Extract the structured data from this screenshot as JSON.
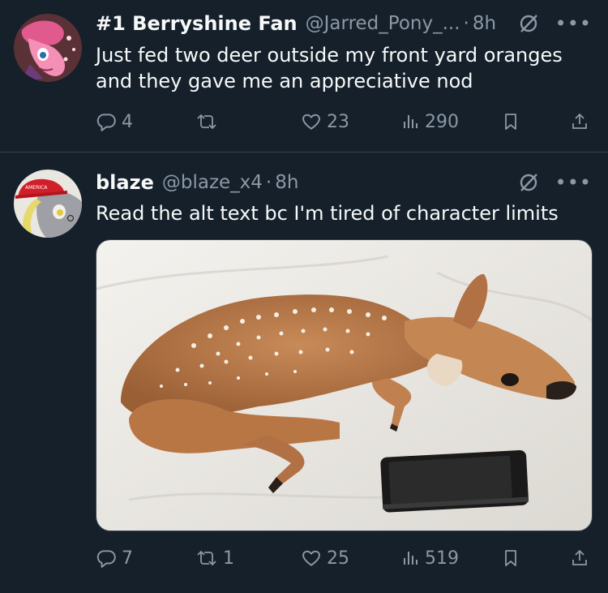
{
  "tweets": [
    {
      "display_name": "#1 Berryshine Fan",
      "handle": "@Jarred_Pony_...",
      "dot": "·",
      "time": "8h",
      "text": "Just fed two deer outside my front yard oranges and they gave me an appreciative nod",
      "avatar": "pink-pony-avatar",
      "replies": "4",
      "retweets": "",
      "likes": "23",
      "views": "290"
    },
    {
      "display_name": "blaze",
      "handle": "@blaze_x4",
      "dot": "·",
      "time": "8h",
      "text": "Read the alt text bc I'm tired of character limits",
      "avatar": "grey-pony-red-cap-avatar",
      "media": "fawn-lying-next-to-phone-photo",
      "replies": "7",
      "retweets": "1",
      "likes": "25",
      "views": "519"
    }
  ],
  "icons": {
    "reply": "reply-icon",
    "retweet": "retweet-icon",
    "like": "heart-icon",
    "views": "views-icon",
    "bookmark": "bookmark-icon",
    "share": "share-icon",
    "grok": "grok-icon",
    "more": "more-icon"
  },
  "colors": {
    "background": "#15202b",
    "text": "#f7f9f9",
    "secondary": "#8b98a5",
    "divider": "#38444d"
  }
}
